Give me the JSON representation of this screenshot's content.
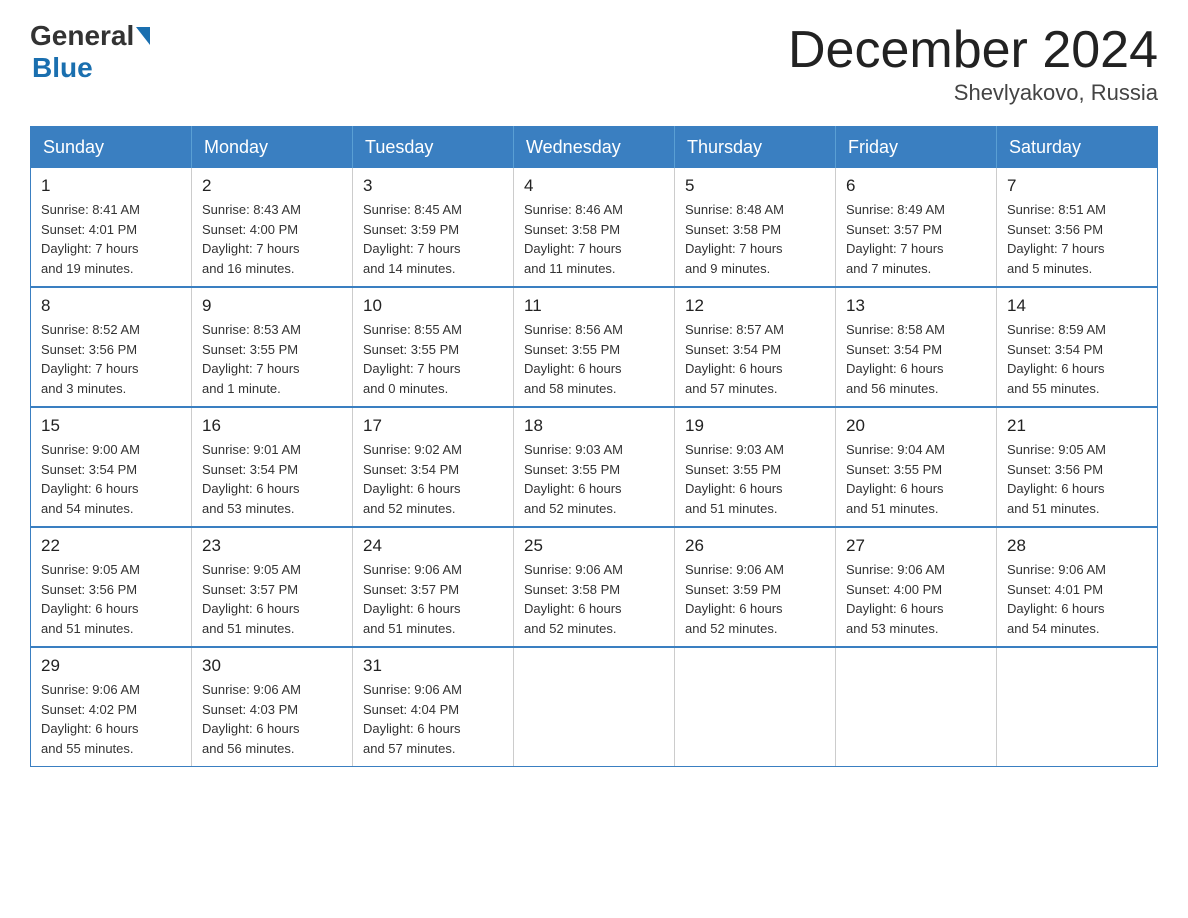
{
  "header": {
    "logo": {
      "general_text": "General",
      "blue_text": "Blue"
    },
    "title": "December 2024",
    "location": "Shevlyakovo, Russia"
  },
  "calendar": {
    "weekdays": [
      "Sunday",
      "Monday",
      "Tuesday",
      "Wednesday",
      "Thursday",
      "Friday",
      "Saturday"
    ],
    "weeks": [
      [
        {
          "day": "1",
          "info": "Sunrise: 8:41 AM\nSunset: 4:01 PM\nDaylight: 7 hours\nand 19 minutes."
        },
        {
          "day": "2",
          "info": "Sunrise: 8:43 AM\nSunset: 4:00 PM\nDaylight: 7 hours\nand 16 minutes."
        },
        {
          "day": "3",
          "info": "Sunrise: 8:45 AM\nSunset: 3:59 PM\nDaylight: 7 hours\nand 14 minutes."
        },
        {
          "day": "4",
          "info": "Sunrise: 8:46 AM\nSunset: 3:58 PM\nDaylight: 7 hours\nand 11 minutes."
        },
        {
          "day": "5",
          "info": "Sunrise: 8:48 AM\nSunset: 3:58 PM\nDaylight: 7 hours\nand 9 minutes."
        },
        {
          "day": "6",
          "info": "Sunrise: 8:49 AM\nSunset: 3:57 PM\nDaylight: 7 hours\nand 7 minutes."
        },
        {
          "day": "7",
          "info": "Sunrise: 8:51 AM\nSunset: 3:56 PM\nDaylight: 7 hours\nand 5 minutes."
        }
      ],
      [
        {
          "day": "8",
          "info": "Sunrise: 8:52 AM\nSunset: 3:56 PM\nDaylight: 7 hours\nand 3 minutes."
        },
        {
          "day": "9",
          "info": "Sunrise: 8:53 AM\nSunset: 3:55 PM\nDaylight: 7 hours\nand 1 minute."
        },
        {
          "day": "10",
          "info": "Sunrise: 8:55 AM\nSunset: 3:55 PM\nDaylight: 7 hours\nand 0 minutes."
        },
        {
          "day": "11",
          "info": "Sunrise: 8:56 AM\nSunset: 3:55 PM\nDaylight: 6 hours\nand 58 minutes."
        },
        {
          "day": "12",
          "info": "Sunrise: 8:57 AM\nSunset: 3:54 PM\nDaylight: 6 hours\nand 57 minutes."
        },
        {
          "day": "13",
          "info": "Sunrise: 8:58 AM\nSunset: 3:54 PM\nDaylight: 6 hours\nand 56 minutes."
        },
        {
          "day": "14",
          "info": "Sunrise: 8:59 AM\nSunset: 3:54 PM\nDaylight: 6 hours\nand 55 minutes."
        }
      ],
      [
        {
          "day": "15",
          "info": "Sunrise: 9:00 AM\nSunset: 3:54 PM\nDaylight: 6 hours\nand 54 minutes."
        },
        {
          "day": "16",
          "info": "Sunrise: 9:01 AM\nSunset: 3:54 PM\nDaylight: 6 hours\nand 53 minutes."
        },
        {
          "day": "17",
          "info": "Sunrise: 9:02 AM\nSunset: 3:54 PM\nDaylight: 6 hours\nand 52 minutes."
        },
        {
          "day": "18",
          "info": "Sunrise: 9:03 AM\nSunset: 3:55 PM\nDaylight: 6 hours\nand 52 minutes."
        },
        {
          "day": "19",
          "info": "Sunrise: 9:03 AM\nSunset: 3:55 PM\nDaylight: 6 hours\nand 51 minutes."
        },
        {
          "day": "20",
          "info": "Sunrise: 9:04 AM\nSunset: 3:55 PM\nDaylight: 6 hours\nand 51 minutes."
        },
        {
          "day": "21",
          "info": "Sunrise: 9:05 AM\nSunset: 3:56 PM\nDaylight: 6 hours\nand 51 minutes."
        }
      ],
      [
        {
          "day": "22",
          "info": "Sunrise: 9:05 AM\nSunset: 3:56 PM\nDaylight: 6 hours\nand 51 minutes."
        },
        {
          "day": "23",
          "info": "Sunrise: 9:05 AM\nSunset: 3:57 PM\nDaylight: 6 hours\nand 51 minutes."
        },
        {
          "day": "24",
          "info": "Sunrise: 9:06 AM\nSunset: 3:57 PM\nDaylight: 6 hours\nand 51 minutes."
        },
        {
          "day": "25",
          "info": "Sunrise: 9:06 AM\nSunset: 3:58 PM\nDaylight: 6 hours\nand 52 minutes."
        },
        {
          "day": "26",
          "info": "Sunrise: 9:06 AM\nSunset: 3:59 PM\nDaylight: 6 hours\nand 52 minutes."
        },
        {
          "day": "27",
          "info": "Sunrise: 9:06 AM\nSunset: 4:00 PM\nDaylight: 6 hours\nand 53 minutes."
        },
        {
          "day": "28",
          "info": "Sunrise: 9:06 AM\nSunset: 4:01 PM\nDaylight: 6 hours\nand 54 minutes."
        }
      ],
      [
        {
          "day": "29",
          "info": "Sunrise: 9:06 AM\nSunset: 4:02 PM\nDaylight: 6 hours\nand 55 minutes."
        },
        {
          "day": "30",
          "info": "Sunrise: 9:06 AM\nSunset: 4:03 PM\nDaylight: 6 hours\nand 56 minutes."
        },
        {
          "day": "31",
          "info": "Sunrise: 9:06 AM\nSunset: 4:04 PM\nDaylight: 6 hours\nand 57 minutes."
        },
        {
          "day": "",
          "info": ""
        },
        {
          "day": "",
          "info": ""
        },
        {
          "day": "",
          "info": ""
        },
        {
          "day": "",
          "info": ""
        }
      ]
    ]
  }
}
